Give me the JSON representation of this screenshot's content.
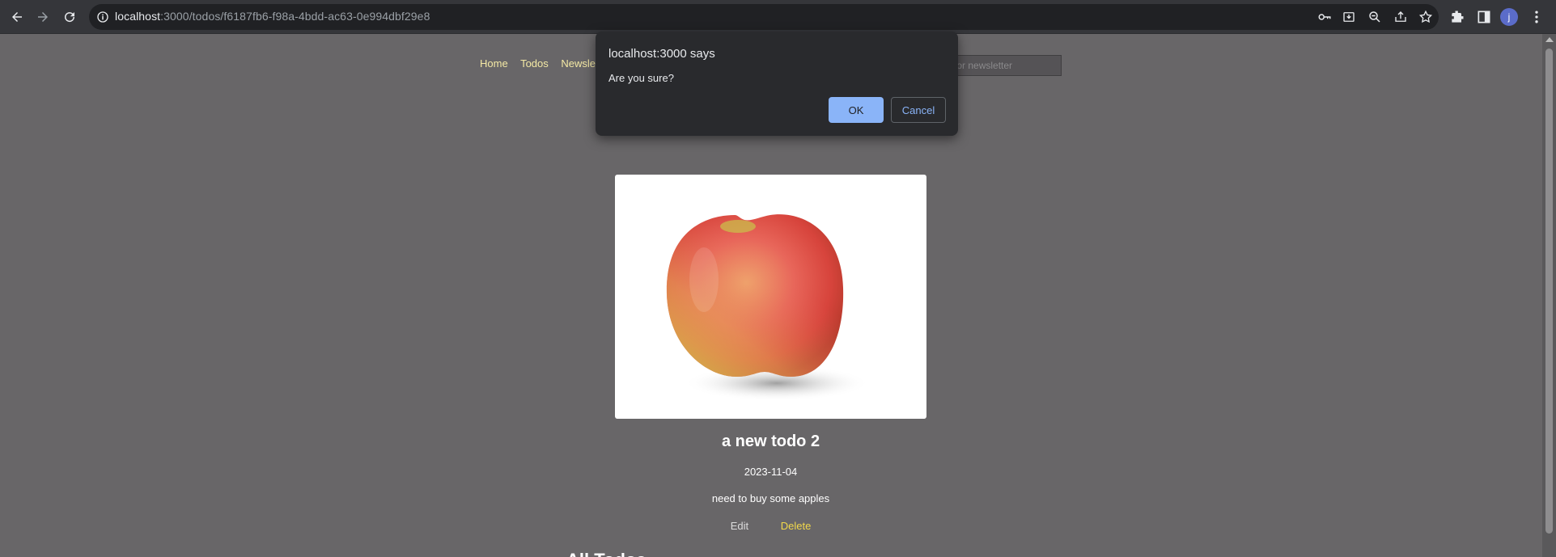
{
  "browser": {
    "url_host": "localhost",
    "url_rest": ":3000/todos/f6187fb6-f98a-4bdd-ac63-0e994dbf29e8",
    "avatar_letter": "j",
    "icons": [
      "back-icon",
      "forward-icon",
      "reload-icon",
      "info-icon",
      "key-icon",
      "install-icon",
      "zoom-icon",
      "share-icon",
      "star-icon",
      "extensions-icon",
      "side-panel-icon",
      "menu-icon"
    ]
  },
  "nav": {
    "home": "Home",
    "todos": "Todos",
    "newsletter": "Newslett"
  },
  "newsletter": {
    "placeholder": "p for newsletter"
  },
  "todo": {
    "image_alt": "apple",
    "title": "a new todo 2",
    "date": "2023-11-04",
    "description": "need to buy some apples",
    "edit_label": "Edit",
    "delete_label": "Delete"
  },
  "next_heading": "All Todos",
  "dialog": {
    "title": "localhost:3000 says",
    "message": "Are you sure?",
    "ok_label": "OK",
    "cancel_label": "Cancel"
  },
  "colors": {
    "page_bg": "#686668",
    "nav_link": "#f4e9a5",
    "delete_link": "#f1d84b",
    "ok_button": "#8ab4f8",
    "dialog_bg": "#292a2d"
  }
}
